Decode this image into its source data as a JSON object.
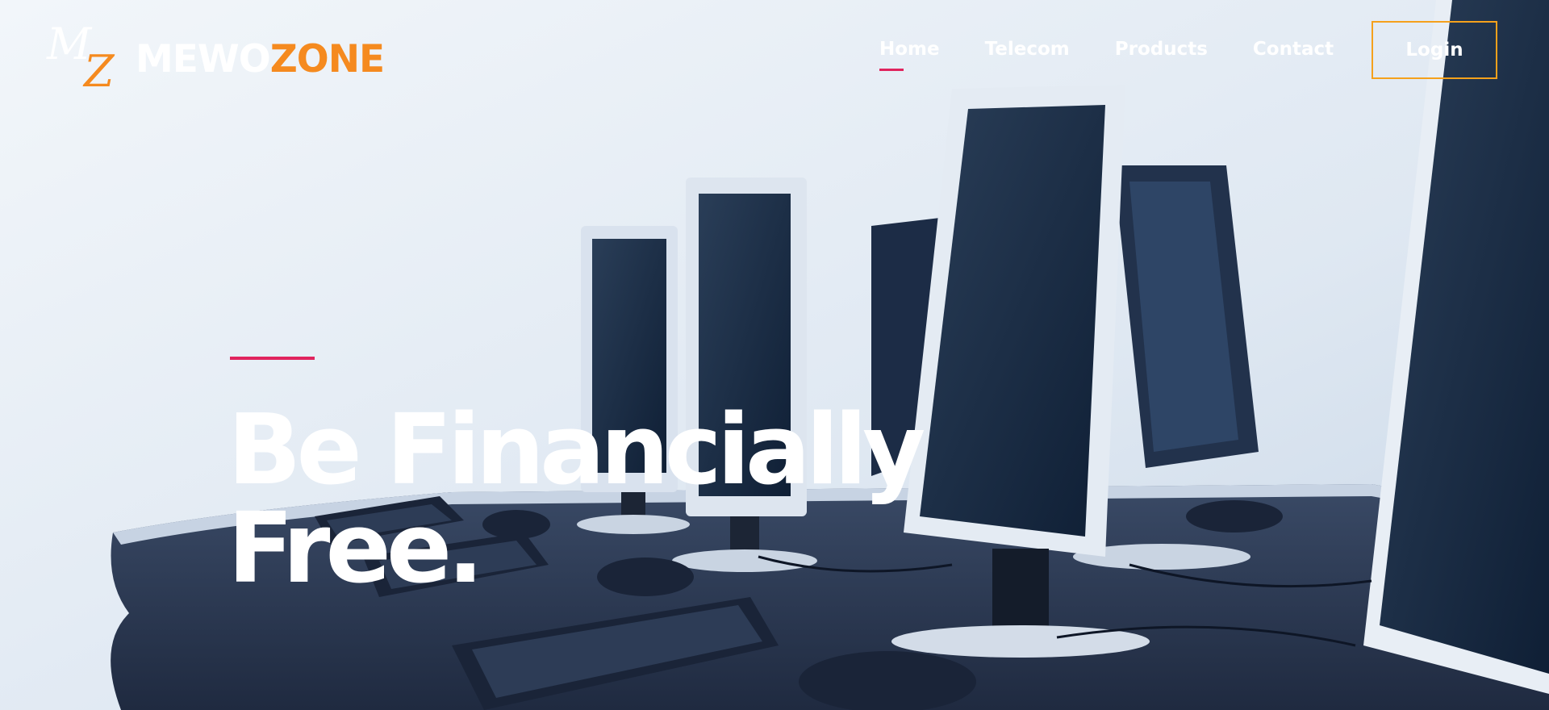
{
  "brand": {
    "mark_m": "M",
    "mark_z": "Z",
    "name_part1": "MEWO",
    "name_part2": "ZONE",
    "color_white": "#ffffff",
    "color_orange": "#f58a1f"
  },
  "nav": {
    "items": [
      {
        "label": "Home",
        "active": true
      },
      {
        "label": "Telecom",
        "active": false
      },
      {
        "label": "Products",
        "active": false
      },
      {
        "label": "Contact",
        "active": false
      }
    ],
    "login_label": "Login",
    "active_underline_color": "#e0245e",
    "login_border_color": "#f5a11c"
  },
  "hero": {
    "title_line1": "Be Financially",
    "title_line2": "Free.",
    "accent_color": "#e0245e",
    "background_image": "office-computers-photo"
  }
}
